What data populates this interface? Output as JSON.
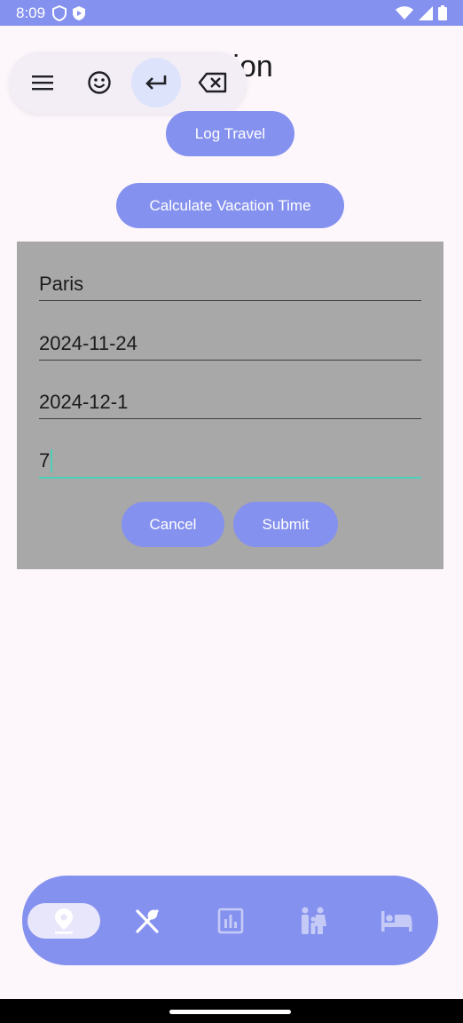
{
  "status_bar": {
    "time": "8:09"
  },
  "page": {
    "title": "Vacation"
  },
  "buttons": {
    "log_travel": "Log Travel",
    "calculate": "Calculate Vacation Time"
  },
  "dialog": {
    "fields": [
      {
        "value": "Paris"
      },
      {
        "value": "2024-11-24"
      },
      {
        "value": "2024-12-1"
      },
      {
        "value": "7"
      }
    ],
    "cancel_label": "Cancel",
    "submit_label": "Submit"
  },
  "keyboard_toolbar": {
    "items": [
      "menu-icon",
      "emoji-icon",
      "enter-icon",
      "backspace-icon"
    ]
  },
  "bottom_nav": {
    "items": [
      {
        "icon": "location-pin-icon",
        "selected": true
      },
      {
        "icon": "restaurant-icon",
        "selected": false
      },
      {
        "icon": "chart-icon",
        "selected": false
      },
      {
        "icon": "family-icon",
        "selected": false
      },
      {
        "icon": "hotel-icon",
        "selected": false
      }
    ]
  },
  "colors": {
    "accent": "#8591ee",
    "focus": "#4dd0b9",
    "dialog_bg": "#a8a8a8",
    "background": "#fdf7fc"
  }
}
